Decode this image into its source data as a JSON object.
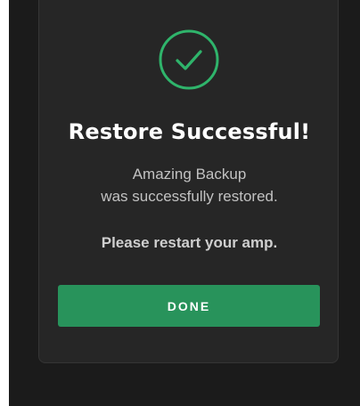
{
  "dialog": {
    "title": "Restore Successful!",
    "message_line1": "Amazing Backup",
    "message_line2": "was successfully restored.",
    "instruction": "Please restart your amp.",
    "done_label": "DONE",
    "icon": "check-circle-icon"
  },
  "colors": {
    "accent": "#28935b",
    "check": "#2fb46b",
    "dialog_bg": "#262626",
    "backdrop": "#1b1b1b"
  }
}
